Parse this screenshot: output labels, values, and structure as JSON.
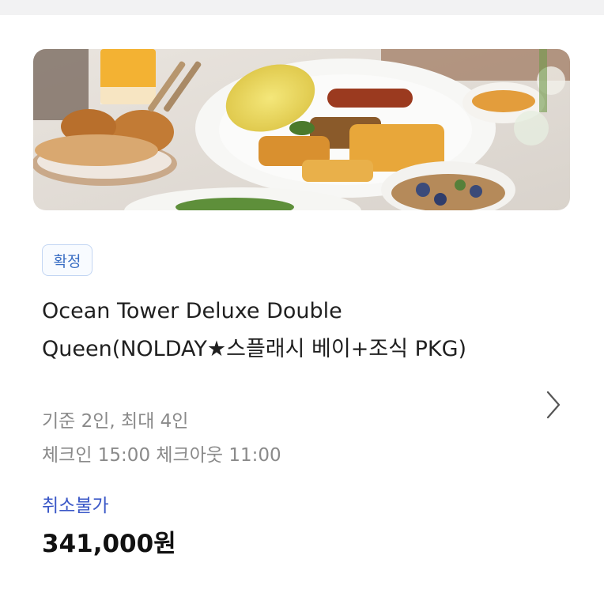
{
  "room": {
    "status_badge": "확정",
    "title": "Ocean Tower Deluxe Double Queen(NOLDAY★스플래시 베이+조식 PKG)",
    "capacity": "기준 2인, 최대 4인",
    "checkin_checkout": "체크인 15:00 체크아웃 11:00",
    "cancel_policy": "취소불가",
    "price": "341,000원"
  },
  "colors": {
    "badge_text": "#3b6fc4",
    "badge_border": "#c3d6f3",
    "cancel_policy": "#3a57c7",
    "price": "#111111"
  },
  "icons": {
    "gallery": "gallery-icon",
    "detail": "chevron-right-icon"
  }
}
